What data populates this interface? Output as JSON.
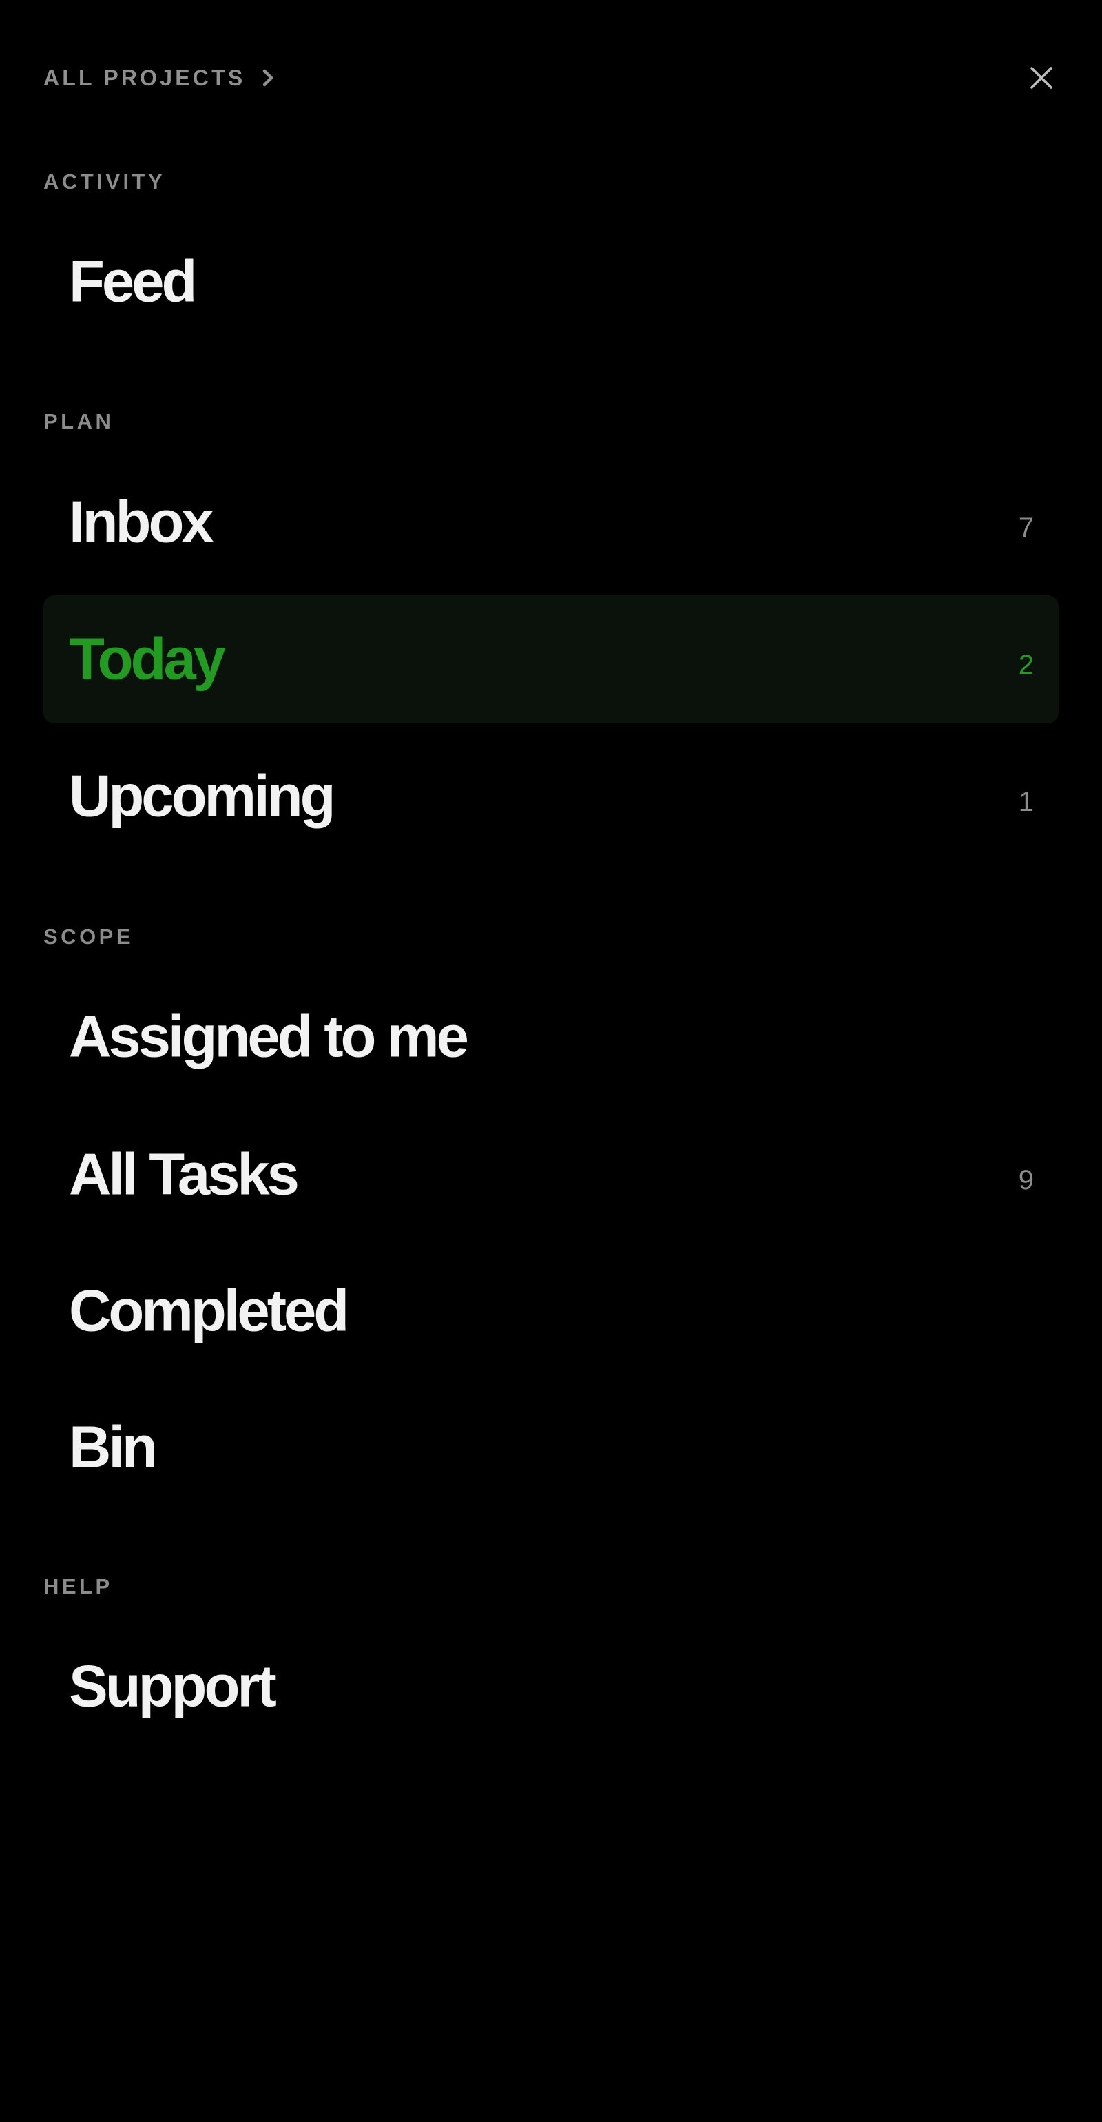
{
  "header": {
    "breadcrumb_label": "ALL PROJECTS",
    "breadcrumb_icon": "chevron-right-icon",
    "close_icon": "close-icon"
  },
  "sections": {
    "activity": {
      "label": "ACTIVITY",
      "items": [
        {
          "label": "Feed",
          "count": ""
        }
      ]
    },
    "plan": {
      "label": "PLAN",
      "items": [
        {
          "label": "Inbox",
          "count": "7"
        },
        {
          "label": "Today",
          "count": "2",
          "active": true
        },
        {
          "label": "Upcoming",
          "count": "1"
        }
      ]
    },
    "scope": {
      "label": "SCOPE",
      "items": [
        {
          "label": "Assigned to me",
          "count": ""
        },
        {
          "label": "All Tasks",
          "count": "9"
        },
        {
          "label": "Completed",
          "count": ""
        },
        {
          "label": "Bin",
          "count": ""
        }
      ]
    },
    "help": {
      "label": "HELP",
      "items": [
        {
          "label": "Support",
          "count": ""
        }
      ]
    }
  },
  "colors": {
    "background": "#000000",
    "text_primary": "#f2f2f2",
    "text_muted": "#8c8c8c",
    "accent_green": "#239b23",
    "active_row_bg": "#0b120b"
  }
}
